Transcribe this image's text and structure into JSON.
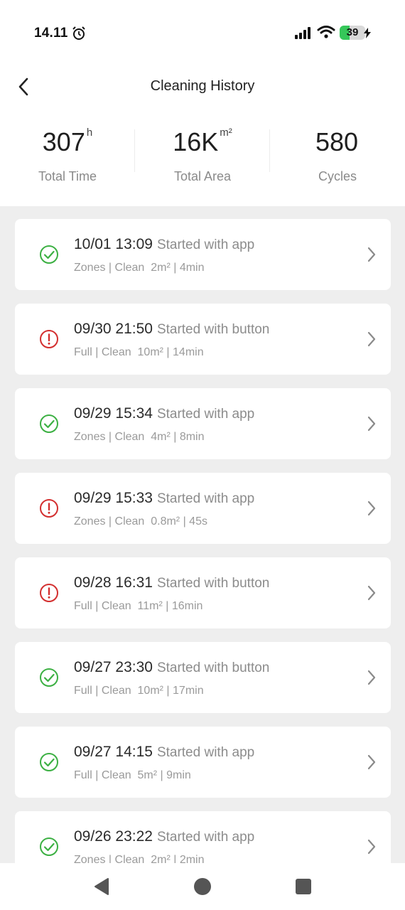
{
  "status_bar": {
    "time": "14.11",
    "battery_level": "39",
    "battery_fraction": 0.39,
    "icons": [
      "alarm-icon",
      "signal-icon",
      "wifi-icon",
      "battery-icon",
      "charging-bolt-icon"
    ]
  },
  "header": {
    "title": "Cleaning History",
    "back_icon": "chevron-left-icon"
  },
  "stats": [
    {
      "value": "307",
      "unit": "h",
      "label": "Total Time"
    },
    {
      "value": "16K",
      "unit": "m²",
      "label": "Total Area"
    },
    {
      "value": "580",
      "unit": "",
      "label": "Cycles"
    }
  ],
  "colors": {
    "success": "#3cb043",
    "error": "#d32f2f",
    "list_background": "#eeeeee"
  },
  "records": [
    {
      "status": "success",
      "datetime": "10/01 13:09",
      "source": "Started with app",
      "mode": "Zones | Clean",
      "area": "2m²",
      "duration": "4min"
    },
    {
      "status": "error",
      "datetime": "09/30 21:50",
      "source": "Started with button",
      "mode": "Full | Clean",
      "area": "10m²",
      "duration": "14min"
    },
    {
      "status": "success",
      "datetime": "09/29 15:34",
      "source": "Started with app",
      "mode": "Zones | Clean",
      "area": "4m²",
      "duration": "8min"
    },
    {
      "status": "error",
      "datetime": "09/29 15:33",
      "source": "Started with app",
      "mode": "Zones | Clean",
      "area": "0.8m²",
      "duration": "45s"
    },
    {
      "status": "error",
      "datetime": "09/28 16:31",
      "source": "Started with button",
      "mode": "Full | Clean",
      "area": "11m²",
      "duration": "16min"
    },
    {
      "status": "success",
      "datetime": "09/27 23:30",
      "source": "Started with button",
      "mode": "Full | Clean",
      "area": "10m²",
      "duration": "17min"
    },
    {
      "status": "success",
      "datetime": "09/27 14:15",
      "source": "Started with app",
      "mode": "Full | Clean",
      "area": "5m²",
      "duration": "9min"
    },
    {
      "status": "success",
      "datetime": "09/26 23:22",
      "source": "Started with app",
      "mode": "Zones | Clean",
      "area": "2m²",
      "duration": "2min"
    }
  ],
  "nav_bar": {
    "buttons": [
      "back-triangle-icon",
      "home-circle-icon",
      "recents-square-icon"
    ]
  }
}
